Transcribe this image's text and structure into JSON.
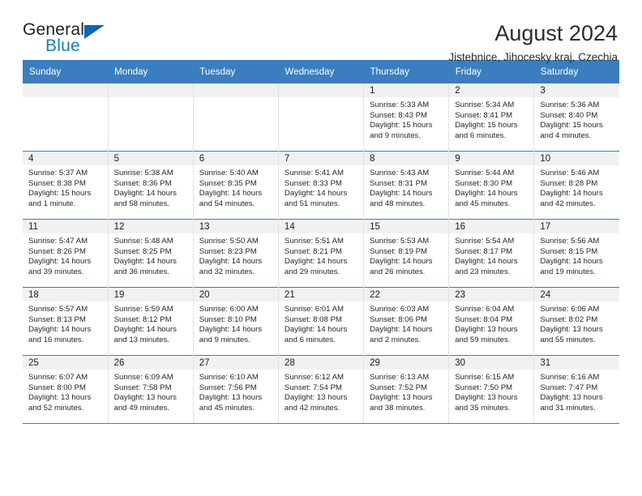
{
  "logo": {
    "word_top": "General",
    "word_bottom": "Blue",
    "accent_color": "#0d66b0",
    "blue_text_color": "#1a7bc4"
  },
  "header": {
    "title": "August 2024",
    "subtitle": "Jistebnice, Jihocesky kraj, Czechia"
  },
  "theme": {
    "header_row_bg": "#3a7ebf",
    "daynum_strip_bg": "#f1f1f1",
    "grid_line": "#e3e3e3"
  },
  "weekday_headers": [
    "Sunday",
    "Monday",
    "Tuesday",
    "Wednesday",
    "Thursday",
    "Friday",
    "Saturday"
  ],
  "weeks": [
    [
      {
        "day": "",
        "sunrise": "",
        "sunset": "",
        "daylight1": "",
        "daylight2": "",
        "empty": true
      },
      {
        "day": "",
        "sunrise": "",
        "sunset": "",
        "daylight1": "",
        "daylight2": "",
        "empty": true
      },
      {
        "day": "",
        "sunrise": "",
        "sunset": "",
        "daylight1": "",
        "daylight2": "",
        "empty": true
      },
      {
        "day": "",
        "sunrise": "",
        "sunset": "",
        "daylight1": "",
        "daylight2": "",
        "empty": true
      },
      {
        "day": "1",
        "sunrise": "Sunrise: 5:33 AM",
        "sunset": "Sunset: 8:43 PM",
        "daylight1": "Daylight: 15 hours",
        "daylight2": "and 9 minutes."
      },
      {
        "day": "2",
        "sunrise": "Sunrise: 5:34 AM",
        "sunset": "Sunset: 8:41 PM",
        "daylight1": "Daylight: 15 hours",
        "daylight2": "and 6 minutes."
      },
      {
        "day": "3",
        "sunrise": "Sunrise: 5:36 AM",
        "sunset": "Sunset: 8:40 PM",
        "daylight1": "Daylight: 15 hours",
        "daylight2": "and 4 minutes."
      }
    ],
    [
      {
        "day": "4",
        "sunrise": "Sunrise: 5:37 AM",
        "sunset": "Sunset: 8:38 PM",
        "daylight1": "Daylight: 15 hours",
        "daylight2": "and 1 minute."
      },
      {
        "day": "5",
        "sunrise": "Sunrise: 5:38 AM",
        "sunset": "Sunset: 8:36 PM",
        "daylight1": "Daylight: 14 hours",
        "daylight2": "and 58 minutes."
      },
      {
        "day": "6",
        "sunrise": "Sunrise: 5:40 AM",
        "sunset": "Sunset: 8:35 PM",
        "daylight1": "Daylight: 14 hours",
        "daylight2": "and 54 minutes."
      },
      {
        "day": "7",
        "sunrise": "Sunrise: 5:41 AM",
        "sunset": "Sunset: 8:33 PM",
        "daylight1": "Daylight: 14 hours",
        "daylight2": "and 51 minutes."
      },
      {
        "day": "8",
        "sunrise": "Sunrise: 5:43 AM",
        "sunset": "Sunset: 8:31 PM",
        "daylight1": "Daylight: 14 hours",
        "daylight2": "and 48 minutes."
      },
      {
        "day": "9",
        "sunrise": "Sunrise: 5:44 AM",
        "sunset": "Sunset: 8:30 PM",
        "daylight1": "Daylight: 14 hours",
        "daylight2": "and 45 minutes."
      },
      {
        "day": "10",
        "sunrise": "Sunrise: 5:46 AM",
        "sunset": "Sunset: 8:28 PM",
        "daylight1": "Daylight: 14 hours",
        "daylight2": "and 42 minutes."
      }
    ],
    [
      {
        "day": "11",
        "sunrise": "Sunrise: 5:47 AM",
        "sunset": "Sunset: 8:26 PM",
        "daylight1": "Daylight: 14 hours",
        "daylight2": "and 39 minutes."
      },
      {
        "day": "12",
        "sunrise": "Sunrise: 5:48 AM",
        "sunset": "Sunset: 8:25 PM",
        "daylight1": "Daylight: 14 hours",
        "daylight2": "and 36 minutes."
      },
      {
        "day": "13",
        "sunrise": "Sunrise: 5:50 AM",
        "sunset": "Sunset: 8:23 PM",
        "daylight1": "Daylight: 14 hours",
        "daylight2": "and 32 minutes."
      },
      {
        "day": "14",
        "sunrise": "Sunrise: 5:51 AM",
        "sunset": "Sunset: 8:21 PM",
        "daylight1": "Daylight: 14 hours",
        "daylight2": "and 29 minutes."
      },
      {
        "day": "15",
        "sunrise": "Sunrise: 5:53 AM",
        "sunset": "Sunset: 8:19 PM",
        "daylight1": "Daylight: 14 hours",
        "daylight2": "and 26 minutes."
      },
      {
        "day": "16",
        "sunrise": "Sunrise: 5:54 AM",
        "sunset": "Sunset: 8:17 PM",
        "daylight1": "Daylight: 14 hours",
        "daylight2": "and 23 minutes."
      },
      {
        "day": "17",
        "sunrise": "Sunrise: 5:56 AM",
        "sunset": "Sunset: 8:15 PM",
        "daylight1": "Daylight: 14 hours",
        "daylight2": "and 19 minutes."
      }
    ],
    [
      {
        "day": "18",
        "sunrise": "Sunrise: 5:57 AM",
        "sunset": "Sunset: 8:13 PM",
        "daylight1": "Daylight: 14 hours",
        "daylight2": "and 16 minutes."
      },
      {
        "day": "19",
        "sunrise": "Sunrise: 5:59 AM",
        "sunset": "Sunset: 8:12 PM",
        "daylight1": "Daylight: 14 hours",
        "daylight2": "and 13 minutes."
      },
      {
        "day": "20",
        "sunrise": "Sunrise: 6:00 AM",
        "sunset": "Sunset: 8:10 PM",
        "daylight1": "Daylight: 14 hours",
        "daylight2": "and 9 minutes."
      },
      {
        "day": "21",
        "sunrise": "Sunrise: 6:01 AM",
        "sunset": "Sunset: 8:08 PM",
        "daylight1": "Daylight: 14 hours",
        "daylight2": "and 6 minutes."
      },
      {
        "day": "22",
        "sunrise": "Sunrise: 6:03 AM",
        "sunset": "Sunset: 8:06 PM",
        "daylight1": "Daylight: 14 hours",
        "daylight2": "and 2 minutes."
      },
      {
        "day": "23",
        "sunrise": "Sunrise: 6:04 AM",
        "sunset": "Sunset: 8:04 PM",
        "daylight1": "Daylight: 13 hours",
        "daylight2": "and 59 minutes."
      },
      {
        "day": "24",
        "sunrise": "Sunrise: 6:06 AM",
        "sunset": "Sunset: 8:02 PM",
        "daylight1": "Daylight: 13 hours",
        "daylight2": "and 55 minutes."
      }
    ],
    [
      {
        "day": "25",
        "sunrise": "Sunrise: 6:07 AM",
        "sunset": "Sunset: 8:00 PM",
        "daylight1": "Daylight: 13 hours",
        "daylight2": "and 52 minutes."
      },
      {
        "day": "26",
        "sunrise": "Sunrise: 6:09 AM",
        "sunset": "Sunset: 7:58 PM",
        "daylight1": "Daylight: 13 hours",
        "daylight2": "and 49 minutes."
      },
      {
        "day": "27",
        "sunrise": "Sunrise: 6:10 AM",
        "sunset": "Sunset: 7:56 PM",
        "daylight1": "Daylight: 13 hours",
        "daylight2": "and 45 minutes."
      },
      {
        "day": "28",
        "sunrise": "Sunrise: 6:12 AM",
        "sunset": "Sunset: 7:54 PM",
        "daylight1": "Daylight: 13 hours",
        "daylight2": "and 42 minutes."
      },
      {
        "day": "29",
        "sunrise": "Sunrise: 6:13 AM",
        "sunset": "Sunset: 7:52 PM",
        "daylight1": "Daylight: 13 hours",
        "daylight2": "and 38 minutes."
      },
      {
        "day": "30",
        "sunrise": "Sunrise: 6:15 AM",
        "sunset": "Sunset: 7:50 PM",
        "daylight1": "Daylight: 13 hours",
        "daylight2": "and 35 minutes."
      },
      {
        "day": "31",
        "sunrise": "Sunrise: 6:16 AM",
        "sunset": "Sunset: 7:47 PM",
        "daylight1": "Daylight: 13 hours",
        "daylight2": "and 31 minutes."
      }
    ]
  ]
}
